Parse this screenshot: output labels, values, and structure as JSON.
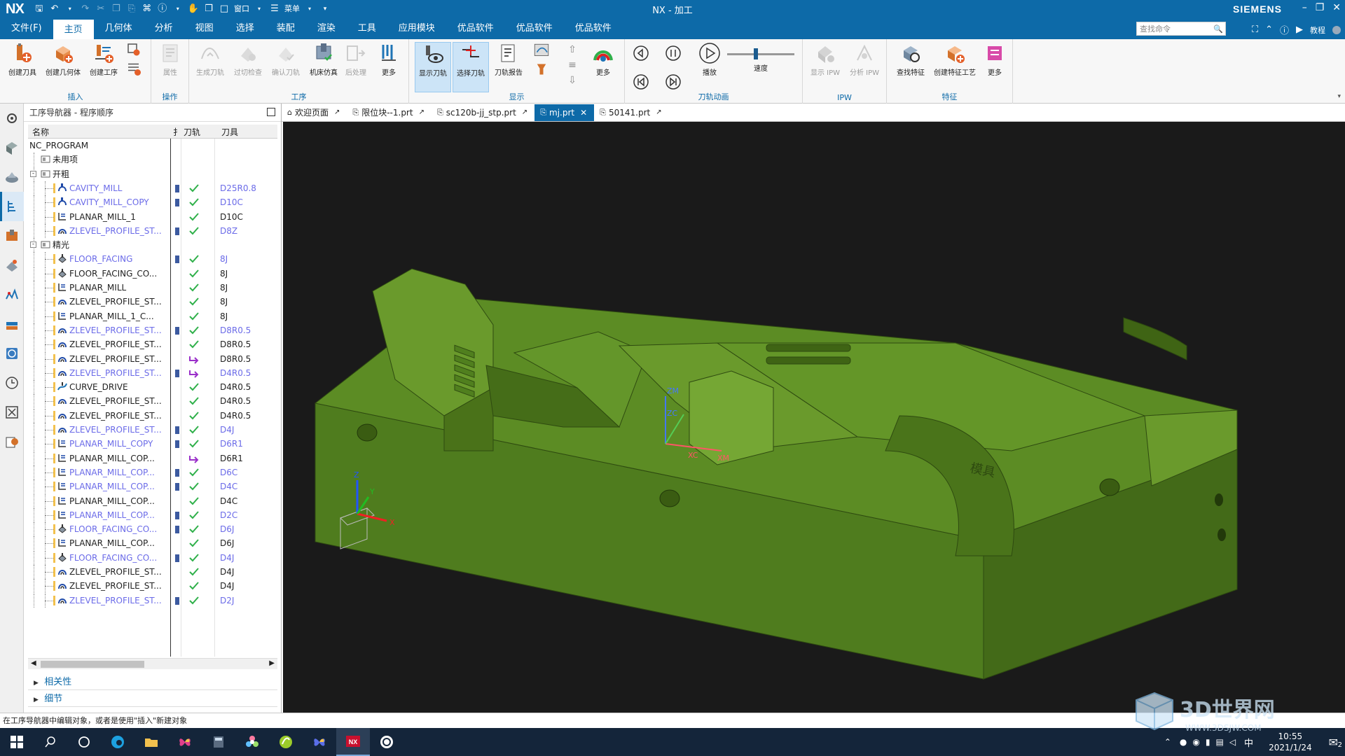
{
  "app": {
    "logo": "NX",
    "title": "NX - 加工",
    "brand": "SIEMENS",
    "quick_menu_label": "窗口",
    "quick_menu2_label": "菜单"
  },
  "menu": {
    "items": [
      "文件(F)",
      "主页",
      "几何体",
      "分析",
      "视图",
      "选择",
      "装配",
      "渲染",
      "工具",
      "应用模块",
      "优品软件",
      "优品软件",
      "优品软件"
    ],
    "active_index": 1,
    "search_placeholder": "查找命令",
    "help_label": "教程"
  },
  "ribbon": {
    "groups": {
      "insert": "插入",
      "operation": "操作",
      "process": "工序",
      "display": "显示",
      "animation": "刀轨动画",
      "ipw": "IPW",
      "feature": "特征"
    },
    "buttons": {
      "create_tool": "创建刀具",
      "create_geometry": "创建几何体",
      "create_operation": "创建工序",
      "properties": "属性",
      "generate_path": "生成刀轨",
      "overcut_check": "过切检查",
      "verify_path": "确认刀轨",
      "machine_sim": "机床仿真",
      "post_process": "后处理",
      "more1": "更多",
      "show_path": "显示刀轨",
      "select_path": "选择刀轨",
      "path_report": "刀轨报告",
      "more2": "更多",
      "play": "播放",
      "speed": "速度",
      "show_ipw": "显示 IPW",
      "analyze_ipw": "分析 IPW",
      "find_feature": "查找特征",
      "create_feature_process": "创建特征工艺",
      "more3": "更多"
    }
  },
  "navigator": {
    "title": "工序导航器 - 程序顺序",
    "columns": {
      "name": "名称",
      "flag": "扌",
      "path": "刀轨",
      "tool": "刀具"
    },
    "rows": [
      {
        "name": "NC_PROGRAM",
        "tool": "",
        "level": 0,
        "type": "root",
        "blue": false,
        "flag": false,
        "path": ""
      },
      {
        "name": "未用项",
        "tool": "",
        "level": 1,
        "type": "folder",
        "blue": false,
        "flag": false,
        "path": ""
      },
      {
        "name": "开粗",
        "tool": "",
        "level": 1,
        "type": "folder-open",
        "blue": false,
        "flag": false,
        "path": ""
      },
      {
        "name": "CAVITY_MILL",
        "tool": "D25R0.8",
        "level": 2,
        "type": "op-cavity",
        "blue": true,
        "flag": true,
        "path": "ok"
      },
      {
        "name": "CAVITY_MILL_COPY",
        "tool": "D10C",
        "level": 2,
        "type": "op-cavity",
        "blue": true,
        "flag": true,
        "path": "ok"
      },
      {
        "name": "PLANAR_MILL_1",
        "tool": "D10C",
        "level": 2,
        "type": "op-planar",
        "blue": false,
        "flag": false,
        "path": "ok"
      },
      {
        "name": "ZLEVEL_PROFILE_ST...",
        "tool": "D8Z",
        "level": 2,
        "type": "op-zlevel",
        "blue": true,
        "flag": true,
        "path": "ok"
      },
      {
        "name": "精光",
        "tool": "",
        "level": 1,
        "type": "folder-open",
        "blue": false,
        "flag": false,
        "path": ""
      },
      {
        "name": "FLOOR_FACING",
        "tool": "8J",
        "level": 2,
        "type": "op-floor",
        "blue": true,
        "flag": true,
        "path": "ok"
      },
      {
        "name": "FLOOR_FACING_CO...",
        "tool": "8J",
        "level": 2,
        "type": "op-floor",
        "blue": false,
        "flag": false,
        "path": "ok"
      },
      {
        "name": "PLANAR_MILL",
        "tool": "8J",
        "level": 2,
        "type": "op-planar",
        "blue": false,
        "flag": false,
        "path": "ok"
      },
      {
        "name": "ZLEVEL_PROFILE_ST...",
        "tool": "8J",
        "level": 2,
        "type": "op-zlevel",
        "blue": false,
        "flag": false,
        "path": "ok"
      },
      {
        "name": "PLANAR_MILL_1_C...",
        "tool": "8J",
        "level": 2,
        "type": "op-planar",
        "blue": false,
        "flag": false,
        "path": "ok"
      },
      {
        "name": "ZLEVEL_PROFILE_ST...",
        "tool": "D8R0.5",
        "level": 2,
        "type": "op-zlevel",
        "blue": true,
        "flag": true,
        "path": "ok"
      },
      {
        "name": "ZLEVEL_PROFILE_ST...",
        "tool": "D8R0.5",
        "level": 2,
        "type": "op-zlevel",
        "blue": false,
        "flag": false,
        "path": "ok"
      },
      {
        "name": "ZLEVEL_PROFILE_ST...",
        "tool": "D8R0.5",
        "level": 2,
        "type": "op-zlevel",
        "blue": false,
        "flag": false,
        "path": "regen"
      },
      {
        "name": "ZLEVEL_PROFILE_ST...",
        "tool": "D4R0.5",
        "level": 2,
        "type": "op-zlevel",
        "blue": true,
        "flag": true,
        "path": "regen"
      },
      {
        "name": "CURVE_DRIVE",
        "tool": "D4R0.5",
        "level": 2,
        "type": "op-curve",
        "blue": false,
        "flag": false,
        "path": "ok"
      },
      {
        "name": "ZLEVEL_PROFILE_ST...",
        "tool": "D4R0.5",
        "level": 2,
        "type": "op-zlevel",
        "blue": false,
        "flag": false,
        "path": "ok"
      },
      {
        "name": "ZLEVEL_PROFILE_ST...",
        "tool": "D4R0.5",
        "level": 2,
        "type": "op-zlevel",
        "blue": false,
        "flag": false,
        "path": "ok"
      },
      {
        "name": "ZLEVEL_PROFILE_ST...",
        "tool": "D4J",
        "level": 2,
        "type": "op-zlevel",
        "blue": true,
        "flag": true,
        "path": "ok"
      },
      {
        "name": "PLANAR_MILL_COPY",
        "tool": "D6R1",
        "level": 2,
        "type": "op-planar",
        "blue": true,
        "flag": true,
        "path": "ok"
      },
      {
        "name": "PLANAR_MILL_COP...",
        "tool": "D6R1",
        "level": 2,
        "type": "op-planar",
        "blue": false,
        "flag": false,
        "path": "regen"
      },
      {
        "name": "PLANAR_MILL_COP...",
        "tool": "D6C",
        "level": 2,
        "type": "op-planar",
        "blue": true,
        "flag": true,
        "path": "ok"
      },
      {
        "name": "PLANAR_MILL_COP...",
        "tool": "D4C",
        "level": 2,
        "type": "op-planar",
        "blue": true,
        "flag": true,
        "path": "ok"
      },
      {
        "name": "PLANAR_MILL_COP...",
        "tool": "D4C",
        "level": 2,
        "type": "op-planar",
        "blue": false,
        "flag": false,
        "path": "ok"
      },
      {
        "name": "PLANAR_MILL_COP...",
        "tool": "D2C",
        "level": 2,
        "type": "op-planar",
        "blue": true,
        "flag": true,
        "path": "ok"
      },
      {
        "name": "FLOOR_FACING_CO...",
        "tool": "D6J",
        "level": 2,
        "type": "op-floor",
        "blue": true,
        "flag": true,
        "path": "ok"
      },
      {
        "name": "PLANAR_MILL_COP...",
        "tool": "D6J",
        "level": 2,
        "type": "op-planar",
        "blue": false,
        "flag": false,
        "path": "ok"
      },
      {
        "name": "FLOOR_FACING_CO...",
        "tool": "D4J",
        "level": 2,
        "type": "op-floor",
        "blue": true,
        "flag": true,
        "path": "ok"
      },
      {
        "name": "ZLEVEL_PROFILE_ST...",
        "tool": "D4J",
        "level": 2,
        "type": "op-zlevel",
        "blue": false,
        "flag": false,
        "path": "ok"
      },
      {
        "name": "ZLEVEL_PROFILE_ST...",
        "tool": "D4J",
        "level": 2,
        "type": "op-zlevel",
        "blue": false,
        "flag": false,
        "path": "ok"
      },
      {
        "name": "ZLEVEL_PROFILE_ST...",
        "tool": "D2J",
        "level": 2,
        "type": "op-zlevel",
        "blue": true,
        "flag": true,
        "path": "ok"
      }
    ],
    "sections": [
      "相关性",
      "细节"
    ]
  },
  "tabs": [
    {
      "label": "欢迎页面",
      "active": false,
      "icon": "home-icon"
    },
    {
      "label": "限位块--1.prt",
      "active": false,
      "icon": "part-icon"
    },
    {
      "label": "sc120b-jj_stp.prt",
      "active": false,
      "icon": "part-icon"
    },
    {
      "label": "mj.prt",
      "active": true,
      "icon": "part-icon"
    },
    {
      "label": "50141.prt",
      "active": false,
      "icon": "part-icon"
    }
  ],
  "viewport": {
    "background": "#1a1a1a",
    "model_color": "#5c8c24",
    "axis_labels": {
      "z": "Z",
      "y": "Y",
      "x": "X",
      "zm": "ZM",
      "zc": "ZC",
      "xc": "XC",
      "xm": "XM"
    },
    "engraving": "模具"
  },
  "status": {
    "message": "在工序导航器中编辑对象，或者是使用\"插入\"新建对象"
  },
  "taskbar": {
    "time": "10:55",
    "date": "2021/1/24",
    "ime": "中",
    "notifications": "2"
  },
  "watermark": {
    "text": "3D世界网",
    "url": "WWW.3DSJW.COM"
  },
  "colors": {
    "accent": "#0d6aa8",
    "check": "#2fb04a",
    "regen": "#9a2fc9",
    "blue_text": "#6b6be8"
  }
}
